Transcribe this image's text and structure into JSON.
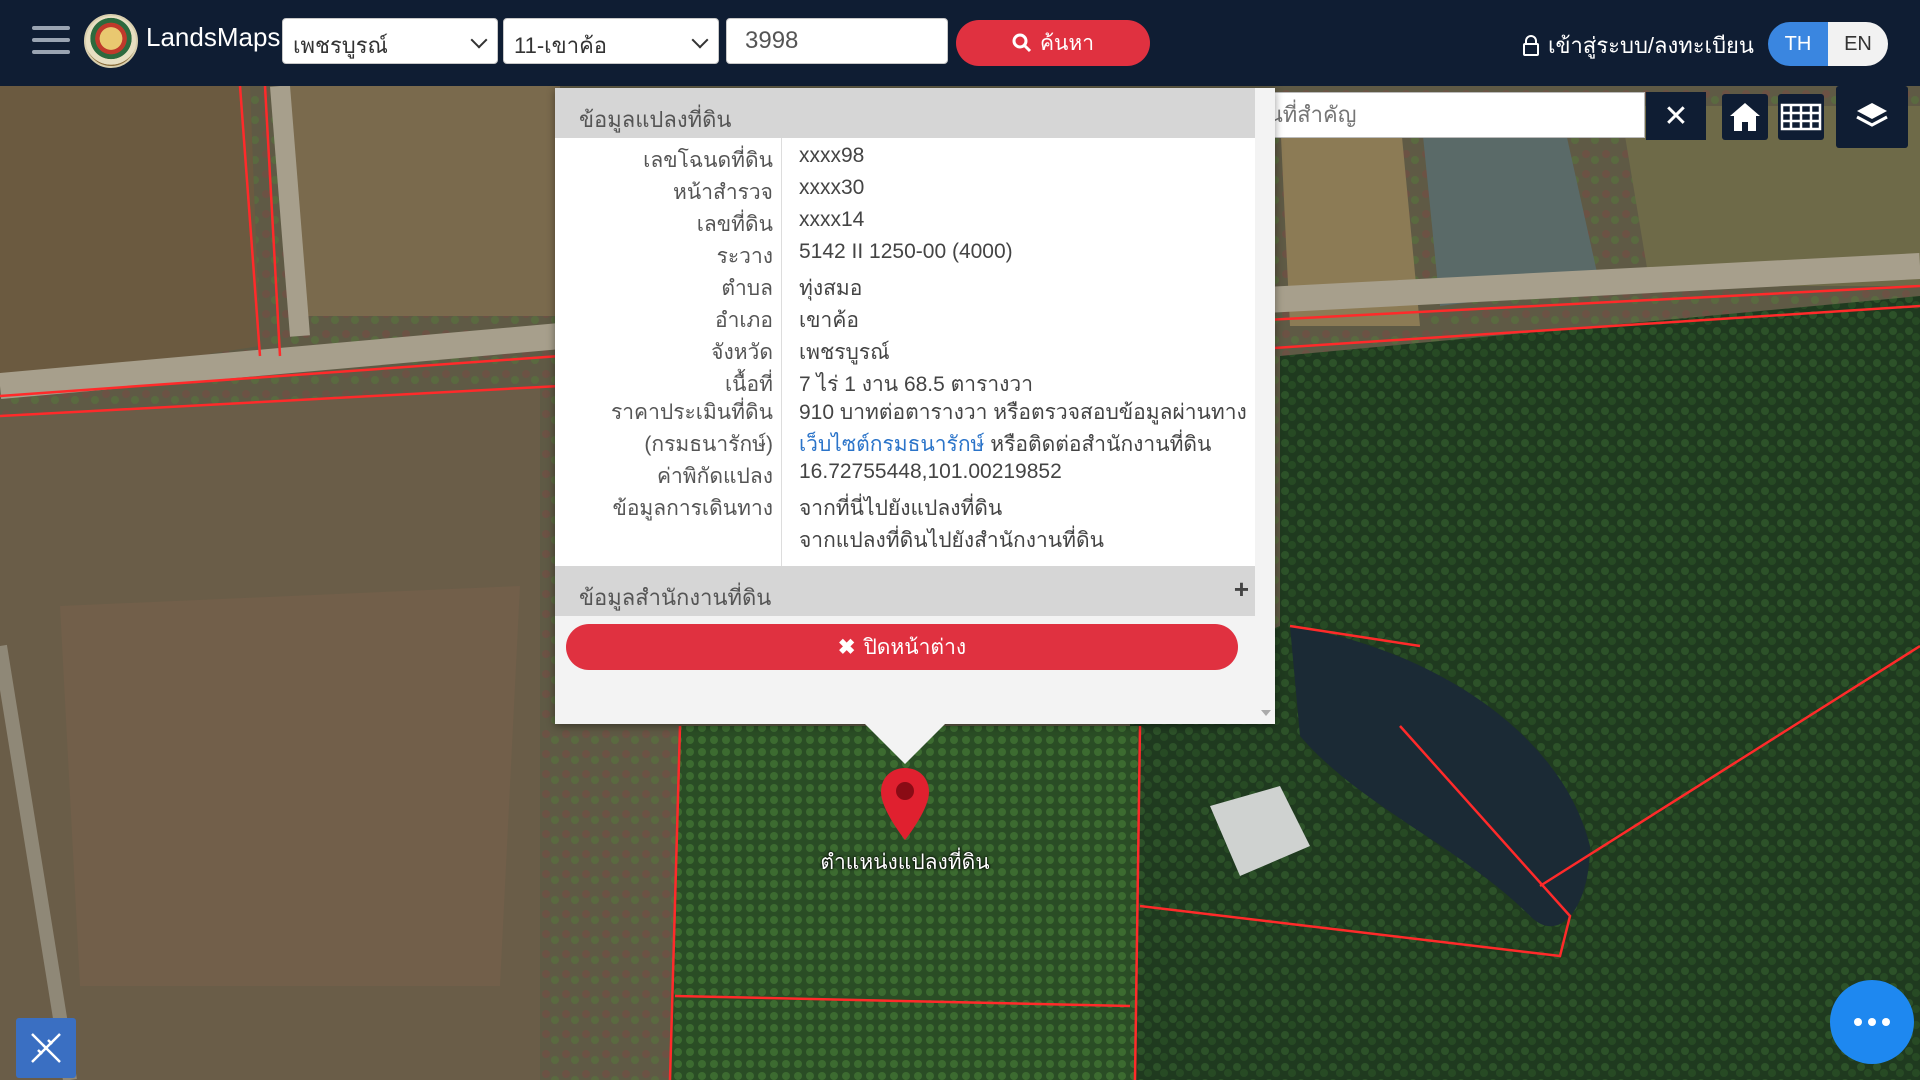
{
  "header": {
    "brand": "LandsMaps",
    "province_selected": "เพชรบูรณ์",
    "district_selected": "11-เขาค้อ",
    "parcel_number_value": "3998",
    "search_label": "ค้นหา",
    "login_label": "เข้าสู่ระบบ/ลงทะเบียน",
    "lang_th": "TH",
    "lang_en": "EN"
  },
  "map_tools": {
    "place_search_placeholder": "ค้นหาสถานที่สำคัญ"
  },
  "popup": {
    "section_parcel_title": "ข้อมูลแปลงที่ดิน",
    "rows": [
      {
        "label": "เลขโฉนดที่ดิน",
        "value": "xxxx98"
      },
      {
        "label": "หน้าสำรวจ",
        "value": "xxxx30"
      },
      {
        "label": "เลขที่ดิน",
        "value": "xxxx14"
      },
      {
        "label": "ระวาง",
        "value": "5142 II 1250-00 (4000)"
      },
      {
        "label": "ตำบล",
        "value": "ทุ่งสมอ"
      },
      {
        "label": "อำเภอ",
        "value": "เขาค้อ"
      },
      {
        "label": "จังหวัด",
        "value": "เพชรบูรณ์"
      },
      {
        "label": "เนื้อที่",
        "value": "7 ไร่ 1 งาน 68.5 ตารางวา"
      }
    ],
    "price_label_1": "ราคาประเมินที่ดิน",
    "price_label_2": "(กรมธนารักษ์)",
    "price_value_1": "910 บาทต่อตารางวา หรือตรวจสอบข้อมูลผ่านทาง",
    "price_link": "เว็บไซต์กรมธนารักษ์",
    "price_value_2": " หรือติดต่อสำนักงานที่ดิน",
    "coord_label": "ค่าพิกัดแปลง",
    "coord_value": "16.72755448,101.00219852",
    "travel_label": "ข้อมูลการเดินทาง",
    "travel_link_1": "จากที่นี่ไปยังแปลงที่ดิน",
    "travel_link_2": "จากแปลงที่ดินไปยังสำนักงานที่ดิน",
    "section_office_title": "ข้อมูลสำนักงานที่ดิน",
    "close_label": "ปิดหน้าต่าง"
  },
  "marker_label": "ตำแหน่งแปลงที่ดิน",
  "colors": {
    "topbar": "#0f1d33",
    "accent_red": "#e03140",
    "link_blue": "#2b74c9",
    "lang_active": "#3a86e0",
    "fab_blue": "#1e88f0",
    "parcel_line": "#ff2a2a"
  },
  "icons": {
    "menu": "hamburger-icon",
    "search": "magnifier-icon",
    "lock": "lock-icon",
    "clear": "close-icon",
    "home": "home-icon",
    "grid": "grid-icon",
    "layers": "layers-icon",
    "close_popup": "x-icon",
    "marker": "map-pin-icon",
    "measure": "ruler-pencil-icon",
    "more": "more-dots-icon"
  }
}
